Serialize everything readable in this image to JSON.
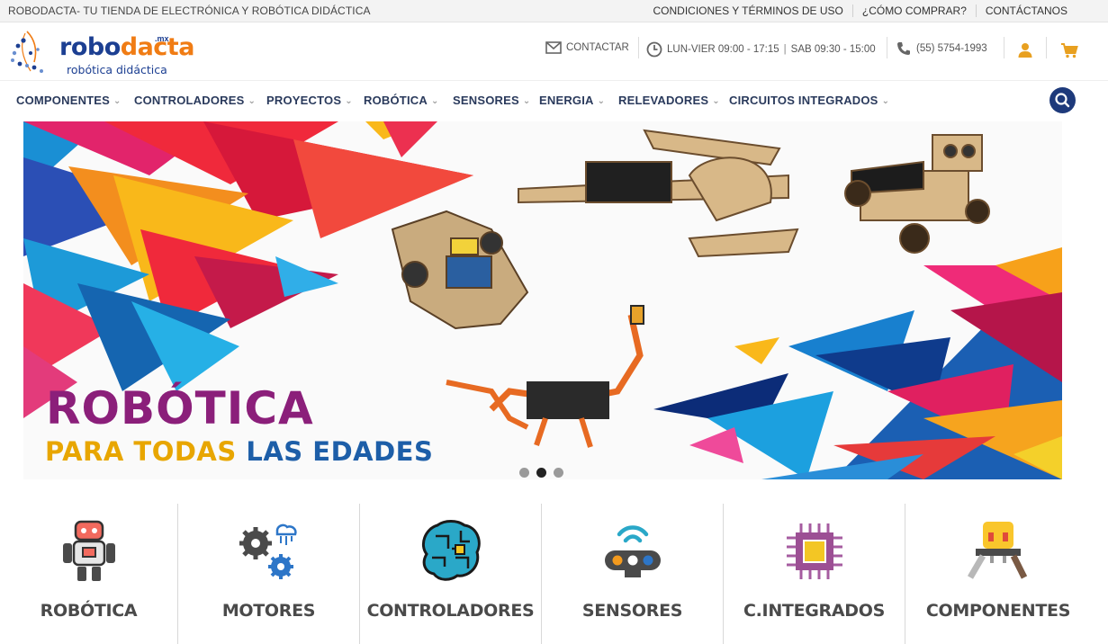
{
  "topbar": {
    "tagline": "ROBODACTA- TU TIENDA DE ELECTRÓNICA Y ROBÓTICA DIDÁCTICA",
    "links": [
      "CONDICIONES Y TÉRMINOS DE USO",
      "¿CÓMO COMPRAR?",
      "CONTÁCTANOS"
    ]
  },
  "header": {
    "logo_word_a": "robo",
    "logo_word_b": "dacta",
    "logo_mx": ".mx",
    "logo_sub": "robótica didáctica",
    "contact_label": "CONTACTAR",
    "hours_weekday": "LUN-VIER 09:00 - 17:15",
    "hours_sat": "SAB 09:30 - 15:00",
    "phone": "(55) 5754-1993",
    "icons": [
      "envelope-icon",
      "clock-icon",
      "phone-icon",
      "user-icon",
      "cart-icon"
    ]
  },
  "nav": {
    "items": [
      "COMPONENTES",
      "CONTROLADORES",
      "PROYECTOS",
      "ROBÓTICA",
      "SENSORES",
      "ENERGIA",
      "RELEVADORES",
      "CIRCUITOS INTEGRADOS"
    ],
    "search_icon": "search-icon"
  },
  "hero": {
    "title": "ROBÓTICA",
    "sub_a": "PARA TODAS",
    "sub_b": "LAS EDADES",
    "slides": 3,
    "active_slide": 2
  },
  "categories": [
    {
      "label": "ROBÓTICA",
      "icon": "robot-icon"
    },
    {
      "label": "MOTORES",
      "icon": "gears-icon"
    },
    {
      "label": "CONTROLADORES",
      "icon": "circuit-brain-icon"
    },
    {
      "label": "SENSORES",
      "icon": "sensor-icon"
    },
    {
      "label": "C.INTEGRADOS",
      "icon": "chip-icon"
    },
    {
      "label": "COMPONENTES",
      "icon": "component-icon"
    }
  ],
  "colors": {
    "brand_blue": "#1c3f92",
    "brand_orange": "#f07c14",
    "hero_purple": "#8b1f7a",
    "hero_yellow": "#e8a600",
    "hero_blue": "#1d5ea8",
    "nav_text": "#2a3a5c"
  }
}
